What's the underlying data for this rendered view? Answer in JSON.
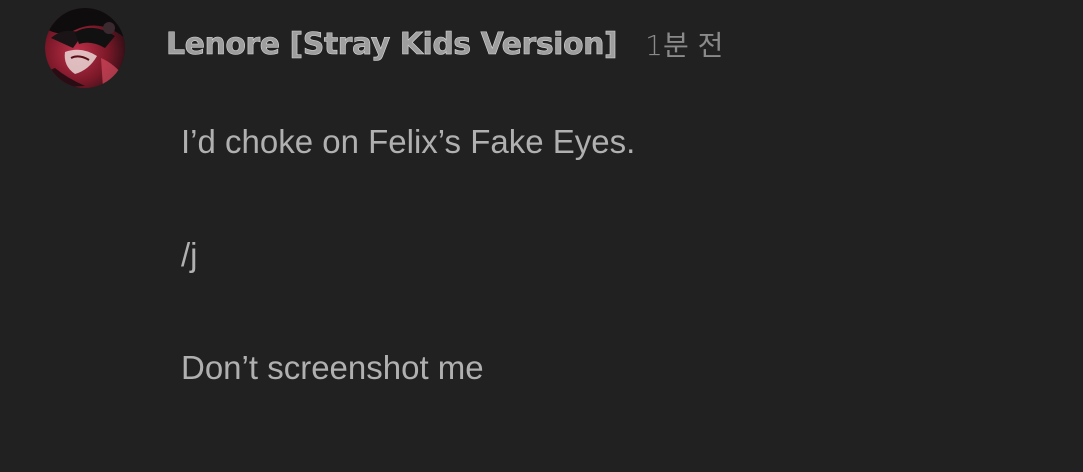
{
  "comment": {
    "author": "Lenore [Stray Kids Version]",
    "timestamp": "1분 전",
    "lines": [
      "I’d choke on Felix’s Fake Eyes.",
      "/j",
      "Don’t screenshot me"
    ]
  },
  "avatar": {
    "icon": "user-avatar-icon"
  },
  "colors": {
    "background": "#212121",
    "author": "#a8a8a8",
    "timestamp": "#8a8a8a",
    "body_text": "#b0b0b0"
  }
}
